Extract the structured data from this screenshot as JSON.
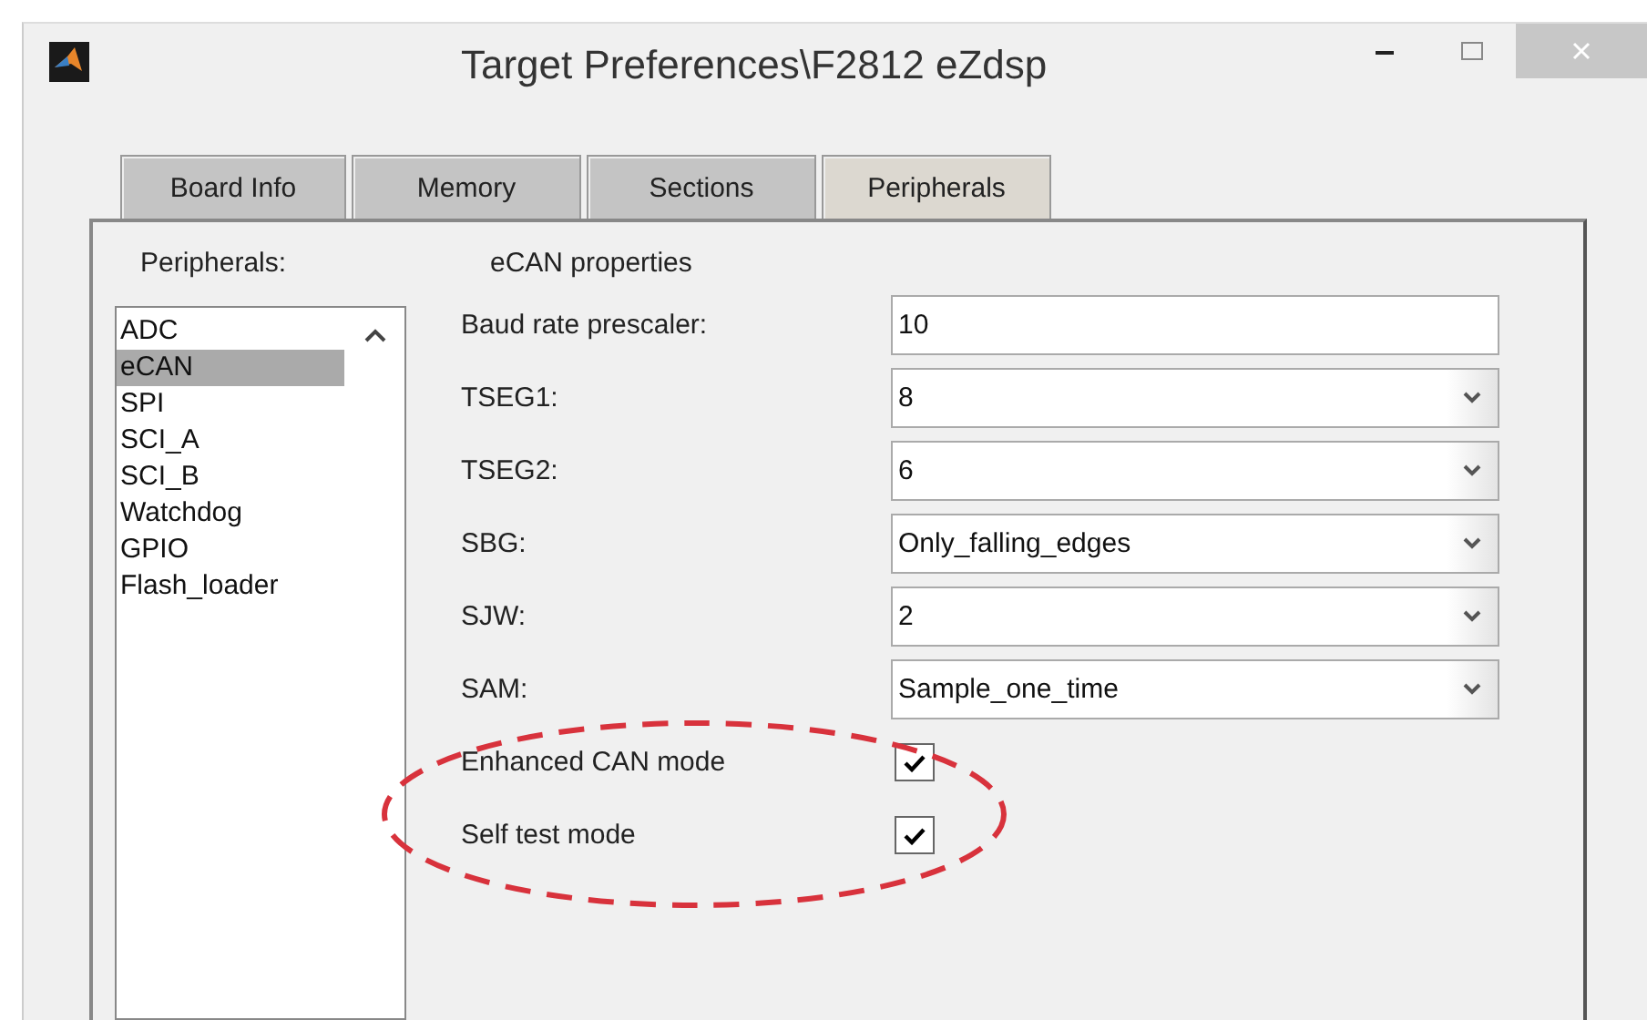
{
  "window": {
    "title": "Target Preferences\\F2812 eZdsp"
  },
  "tabs": [
    {
      "label": "Board Info",
      "selected": false
    },
    {
      "label": "Memory",
      "selected": false
    },
    {
      "label": "Sections",
      "selected": false
    },
    {
      "label": "Peripherals",
      "selected": true
    }
  ],
  "peripherals": {
    "label": "Peripherals:",
    "items": [
      {
        "label": "ADC",
        "selected": false
      },
      {
        "label": "eCAN",
        "selected": true
      },
      {
        "label": "SPI",
        "selected": false
      },
      {
        "label": "SCI_A",
        "selected": false
      },
      {
        "label": "SCI_B",
        "selected": false
      },
      {
        "label": "Watchdog",
        "selected": false
      },
      {
        "label": "GPIO",
        "selected": false
      },
      {
        "label": "Flash_loader",
        "selected": false
      }
    ]
  },
  "properties": {
    "title": "eCAN properties",
    "rows": [
      {
        "kind": "text",
        "label": "Baud rate prescaler:",
        "value": "10"
      },
      {
        "kind": "dropdown",
        "label": "TSEG1:",
        "value": "8"
      },
      {
        "kind": "dropdown",
        "label": "TSEG2:",
        "value": "6"
      },
      {
        "kind": "dropdown",
        "label": "SBG:",
        "value": "Only_falling_edges"
      },
      {
        "kind": "dropdown",
        "label": "SJW:",
        "value": "2"
      },
      {
        "kind": "dropdown",
        "label": "SAM:",
        "value": "Sample_one_time"
      },
      {
        "kind": "checkbox",
        "label": "Enhanced CAN mode",
        "checked": true
      },
      {
        "kind": "checkbox",
        "label": "Self test mode",
        "checked": true
      }
    ]
  }
}
